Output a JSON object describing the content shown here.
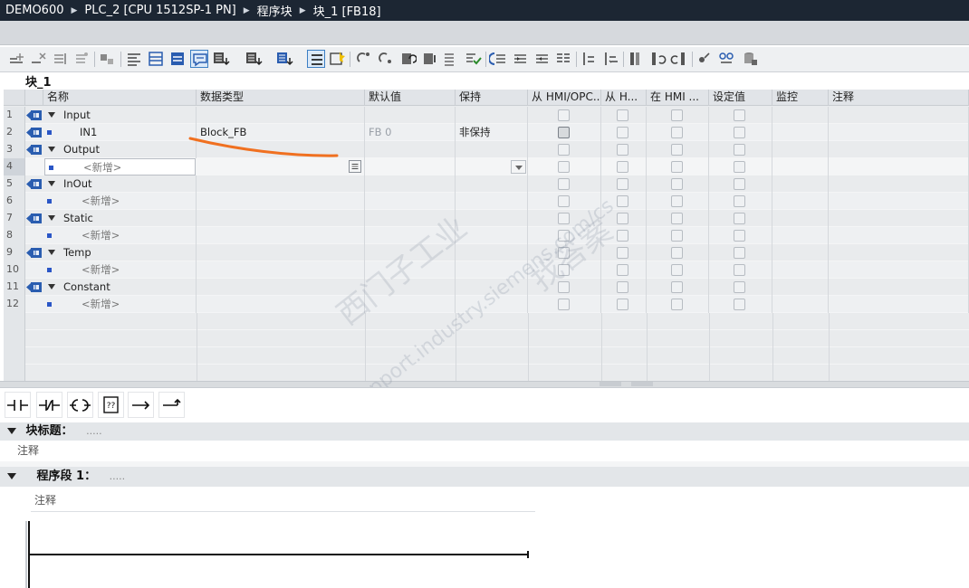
{
  "breadcrumb": [
    "DEMO600",
    "PLC_2 [CPU 1512SP-1 PN]",
    "程序块",
    "块_1 [FB18]"
  ],
  "block_name": "块_1",
  "columns": [
    "名称",
    "数据类型",
    "默认值",
    "保持",
    "从 HMI/OPC..",
    "从 H...",
    "在 HMI ...",
    "设定值",
    "监控",
    "注释"
  ],
  "rows": [
    {
      "num": "1",
      "name": "Input",
      "type": "",
      "default": "",
      "retain": "",
      "kind": "section"
    },
    {
      "num": "2",
      "name": "IN1",
      "type": "Block_FB",
      "default": "FB 0",
      "retain": "非保持",
      "kind": "var"
    },
    {
      "num": "3",
      "name": "Output",
      "type": "",
      "default": "",
      "retain": "",
      "kind": "section"
    },
    {
      "num": "4",
      "name": "<新增>",
      "type": "",
      "default": "",
      "retain": "",
      "kind": "add-selected"
    },
    {
      "num": "5",
      "name": "InOut",
      "type": "",
      "default": "",
      "retain": "",
      "kind": "section"
    },
    {
      "num": "6",
      "name": "<新增>",
      "type": "",
      "default": "",
      "retain": "",
      "kind": "add"
    },
    {
      "num": "7",
      "name": "Static",
      "type": "",
      "default": "",
      "retain": "",
      "kind": "section"
    },
    {
      "num": "8",
      "name": "<新增>",
      "type": "",
      "default": "",
      "retain": "",
      "kind": "add"
    },
    {
      "num": "9",
      "name": "Temp",
      "type": "",
      "default": "",
      "retain": "",
      "kind": "section"
    },
    {
      "num": "10",
      "name": "<新增>",
      "type": "",
      "default": "",
      "retain": "",
      "kind": "add"
    },
    {
      "num": "11",
      "name": "Constant",
      "type": "",
      "default": "",
      "retain": "",
      "kind": "section"
    },
    {
      "num": "12",
      "name": "<新增>",
      "type": "",
      "default": "",
      "retain": "",
      "kind": "add"
    }
  ],
  "block_title": {
    "label": "块标题：",
    "dots": ".....",
    "comment": "注释"
  },
  "network": {
    "label": "程序段 1：",
    "dots": ".....",
    "comment": "注释"
  },
  "watermark": {
    "line1": "西门子工业",
    "line2": "support.industry.siemens.com/cs",
    "brand": "找答案"
  },
  "colors": {
    "breadcrumb_bg": "#1c2633",
    "annotation_stroke": "#f07020",
    "selected_icon_border": "#3c7fc4"
  },
  "toolbar_icons": [
    "insert-row-icon",
    "delete-row-icon",
    "insert-column-icon",
    "expand-icon",
    "link-icon",
    "interface-icon",
    "collapse-icon",
    "expand-all-icon",
    "comment-toggle-icon",
    "download-icon",
    "upload-icon",
    "watch-icon",
    "absolute-info-icon",
    "symbolic-icon",
    "indent-icon",
    "outdent-icon",
    "wildcard-icon",
    "sort-icon",
    "bookmark-icon",
    "previous-icon",
    "next-icon",
    "call-icon",
    "monitor-icon",
    "snapshot-icon"
  ],
  "ladder_icons": [
    "no-contact-icon",
    "nc-contact-icon",
    "coil-icon",
    "empty-box-icon",
    "open-branch-icon",
    "close-branch-icon"
  ]
}
